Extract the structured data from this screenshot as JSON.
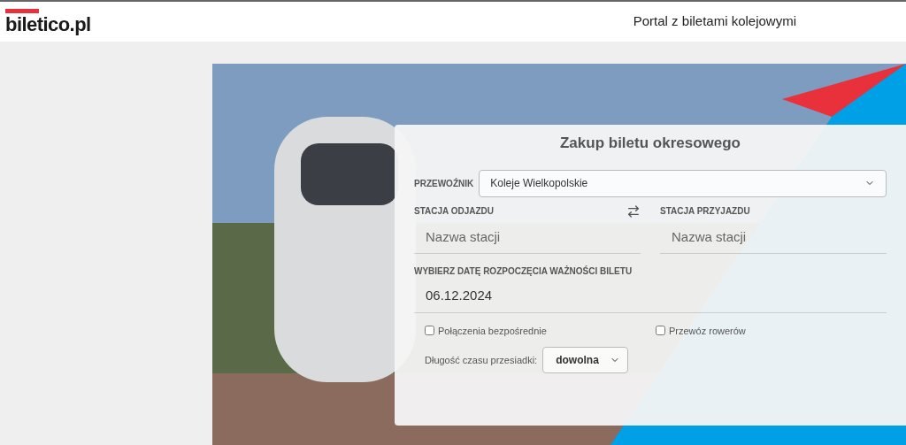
{
  "header": {
    "logo": "biletico.pl",
    "tagline": "Portal z biletami kolejowymi"
  },
  "form": {
    "title": "Zakup biletu okresowego",
    "carrier": {
      "label": "PRZEWOŹNIK",
      "value": "Koleje Wielkopolskie"
    },
    "departure": {
      "label": "STACJA ODJAZDU",
      "placeholder": "Nazwa stacji"
    },
    "arrival": {
      "label": "STACJA PRZYJAZDU",
      "placeholder": "Nazwa stacji"
    },
    "date": {
      "label": "WYBIERZ DATĘ ROZPOCZĘCIA WAŻNOŚCI BILETU",
      "value": "06.12.2024"
    },
    "options": [
      {
        "label": "Połączenia bezpośrednie",
        "checked": false
      },
      {
        "label": "Przewóz rowerów",
        "checked": false
      }
    ],
    "transfer": {
      "label": "Długość czasu przesiadki:",
      "value": "dowolna"
    }
  }
}
